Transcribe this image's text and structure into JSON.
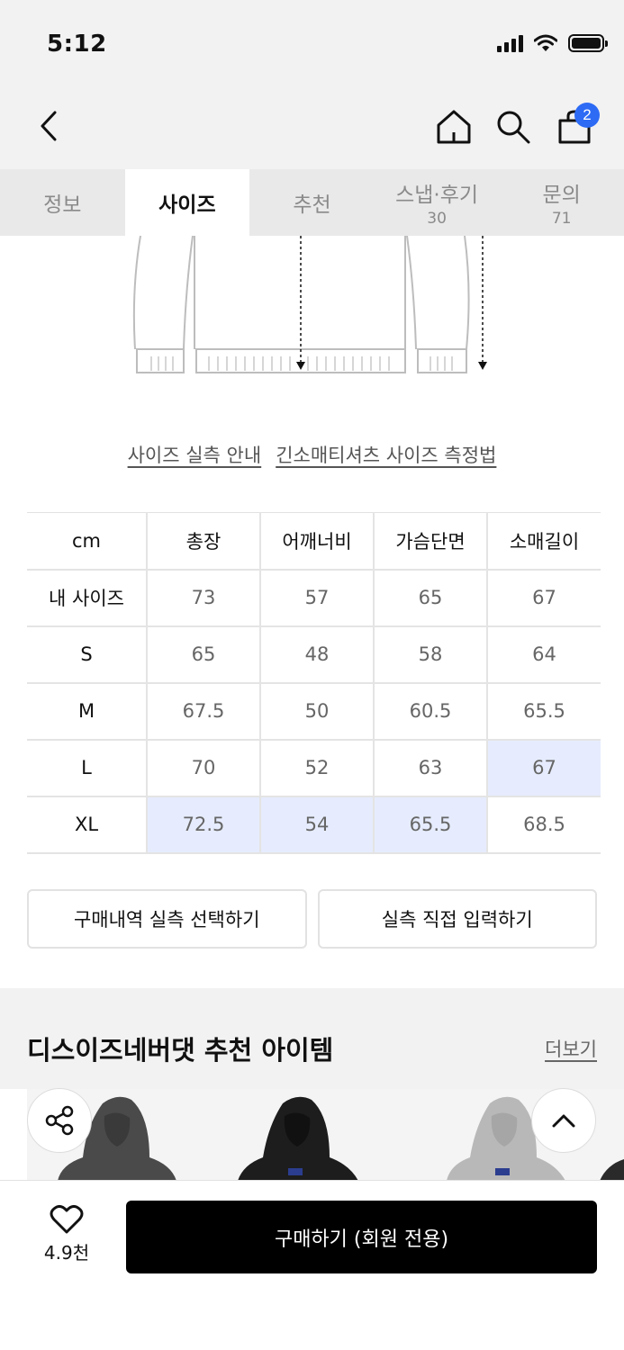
{
  "status_bar": {
    "time": "5:12"
  },
  "header": {
    "cart_count": "2"
  },
  "tabs": [
    {
      "label": "정보",
      "count": ""
    },
    {
      "label": "사이즈",
      "count": ""
    },
    {
      "label": "추천",
      "count": ""
    },
    {
      "label": "스냅·후기",
      "count": "30"
    },
    {
      "label": "문의",
      "count": "71"
    }
  ],
  "guide_links": {
    "measure_guide": "사이즈 실측 안내",
    "method_guide": "긴소매티셔츠 사이즈 측정법"
  },
  "size_table": {
    "unit": "cm",
    "columns": [
      "총장",
      "어깨너비",
      "가슴단면",
      "소매길이"
    ],
    "rows": [
      {
        "size": "내 사이즈",
        "values": [
          "73",
          "57",
          "65",
          "67"
        ]
      },
      {
        "size": "S",
        "values": [
          "65",
          "48",
          "58",
          "64"
        ]
      },
      {
        "size": "M",
        "values": [
          "67.5",
          "50",
          "60.5",
          "65.5"
        ]
      },
      {
        "size": "L",
        "values": [
          "70",
          "52",
          "63",
          "67"
        ]
      },
      {
        "size": "XL",
        "values": [
          "72.5",
          "54",
          "65.5",
          "68.5"
        ]
      }
    ],
    "highlight_color": "#e6ecfd"
  },
  "actions": {
    "select_history": "구매내역 실측 선택하기",
    "manual_input": "실측 직접 입력하기"
  },
  "recommend": {
    "title": "디스이즈네버댓 추천 아이템",
    "more": "더보기"
  },
  "bottom_bar": {
    "like_count": "4.9천",
    "buy_label": "구매하기 (회원 전용)"
  },
  "colors": {
    "accent": "#2d6bf5",
    "buy_button": "#000000"
  }
}
